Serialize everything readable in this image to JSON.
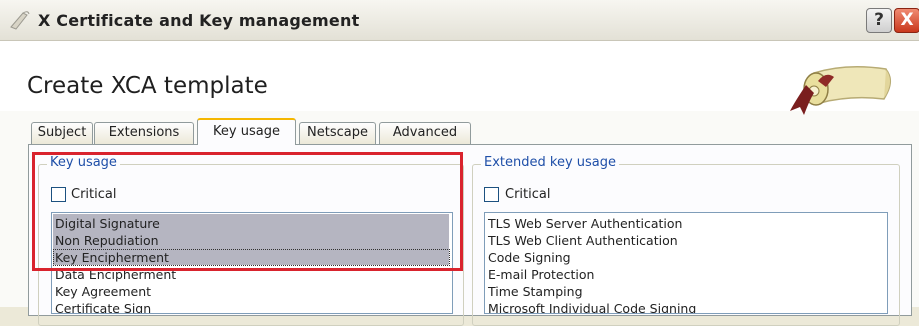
{
  "window": {
    "title": "X Certificate and Key management",
    "help_label": "?",
    "close_label": "X"
  },
  "page": {
    "title": "Create XCA template"
  },
  "tabs": [
    {
      "label": "Subject",
      "active": false
    },
    {
      "label": "Extensions",
      "active": false
    },
    {
      "label": "Key usage",
      "active": true
    },
    {
      "label": "Netscape",
      "active": false
    },
    {
      "label": "Advanced",
      "active": false
    }
  ],
  "key_usage": {
    "group_title": "Key usage",
    "critical_label": "Critical",
    "critical_checked": false,
    "items": [
      {
        "label": "Digital Signature",
        "selected": true
      },
      {
        "label": "Non Repudiation",
        "selected": true
      },
      {
        "label": "Key Encipherment",
        "selected": true
      },
      {
        "label": "Data Encipherment",
        "selected": false
      },
      {
        "label": "Key Agreement",
        "selected": false
      },
      {
        "label": "Certificate Sign",
        "selected": false
      }
    ]
  },
  "extended_key_usage": {
    "group_title": "Extended key usage",
    "critical_label": "Critical",
    "critical_checked": false,
    "items": [
      {
        "label": "TLS Web Server Authentication"
      },
      {
        "label": "TLS Web Client Authentication"
      },
      {
        "label": "Code Signing"
      },
      {
        "label": "E-mail Protection"
      },
      {
        "label": "Time Stamping"
      },
      {
        "label": "Microsoft Individual Code Signing"
      }
    ]
  },
  "colors": {
    "highlight_border": "#d9232d",
    "selection": "#b5b5c1",
    "group_title": "#1f4fa8"
  }
}
